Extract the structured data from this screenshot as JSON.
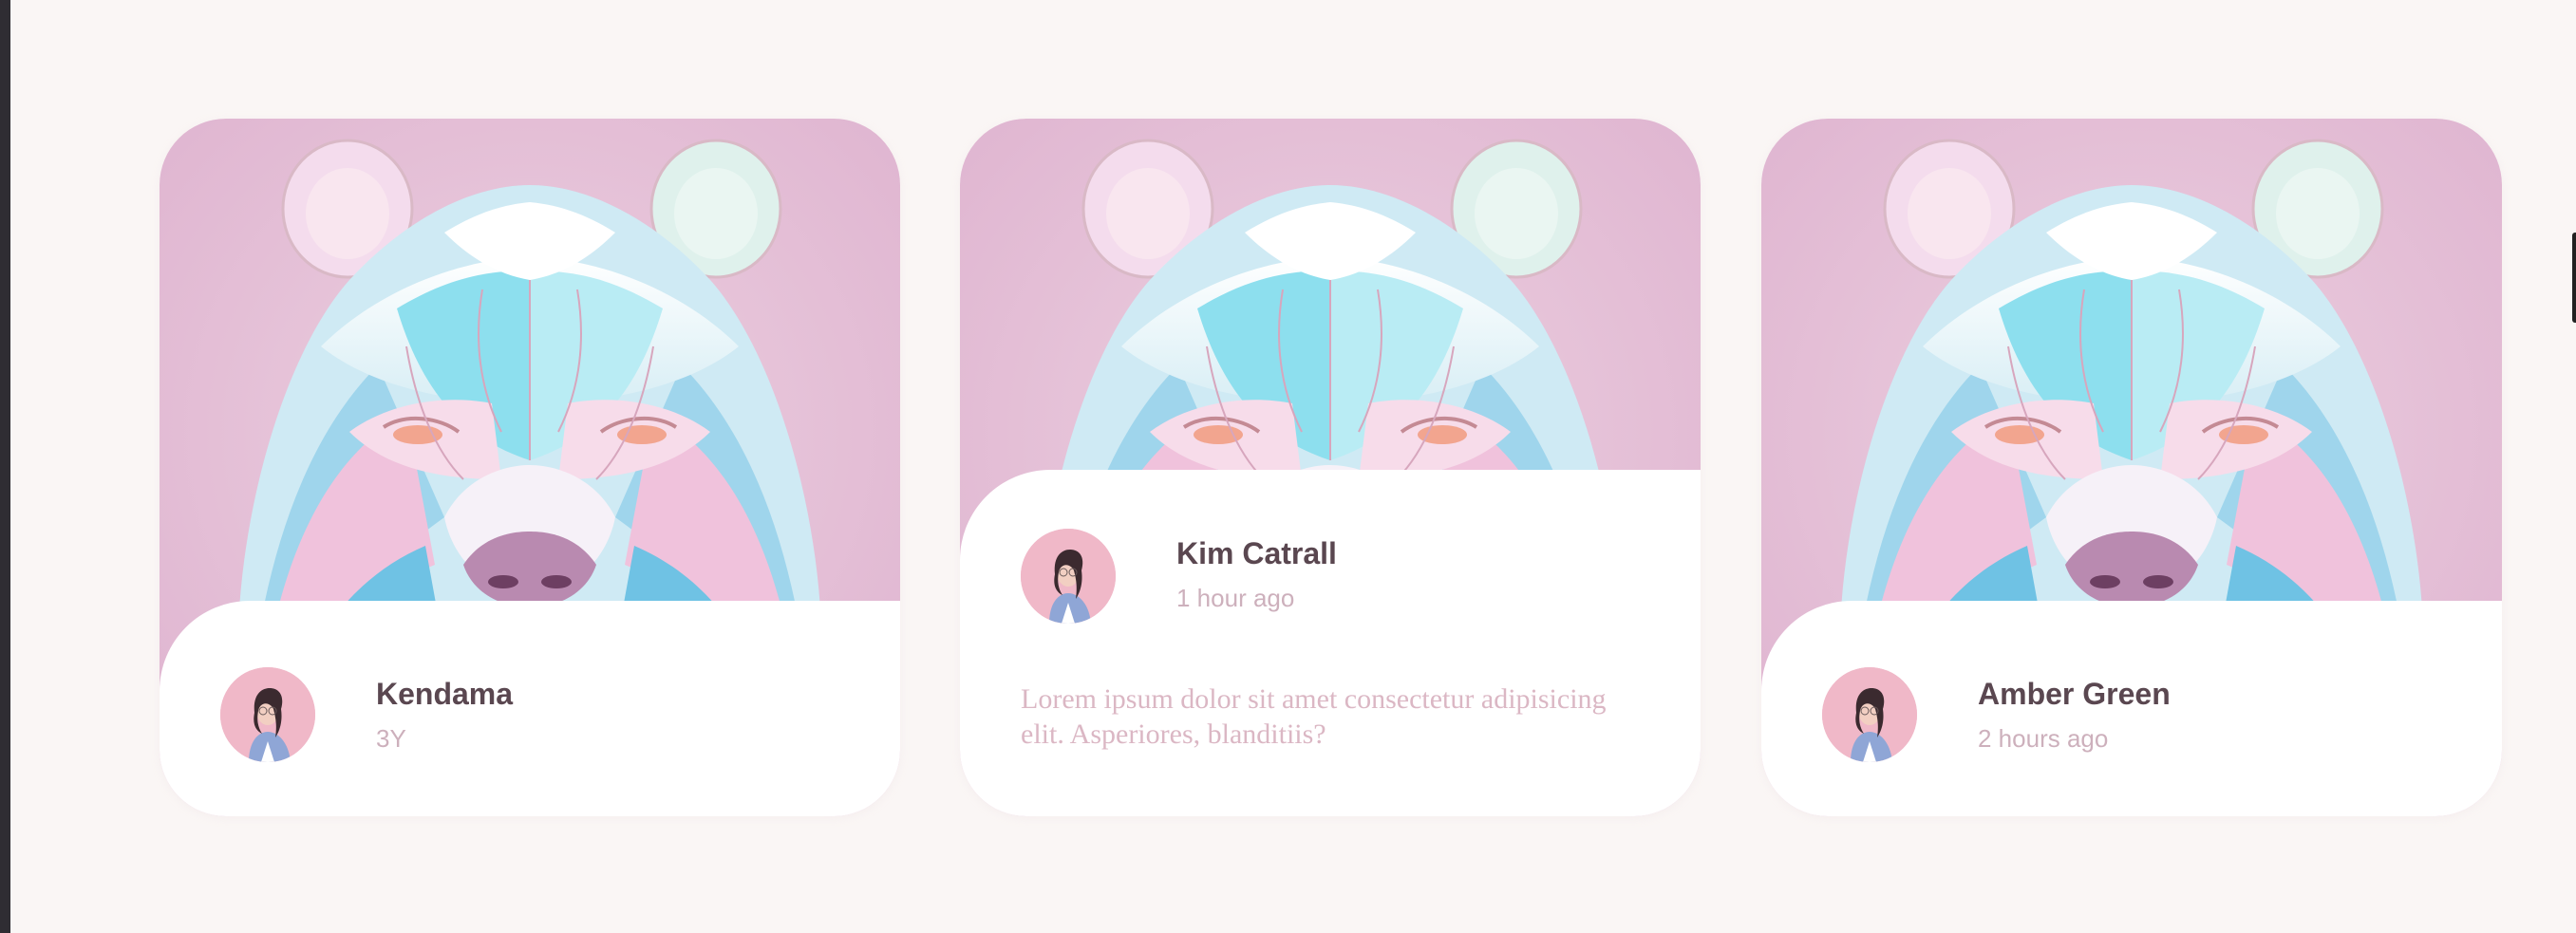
{
  "cards": [
    {
      "name": "Kendama",
      "time": "3Y",
      "description": ""
    },
    {
      "name": "Kim Catrall",
      "time": "1 hour ago",
      "description": "Lorem ipsum dolor sit amet consectetur adipisicing elit. Asperiores, blanditiis?"
    },
    {
      "name": "Amber Green",
      "time": "2 hours ago",
      "description": ""
    }
  ],
  "colors": {
    "background": "#faf6f5",
    "card": "#ffffff",
    "art_background": "#e3bdd6",
    "name": "#5a4750",
    "time": "#cdb0bc",
    "description": "#dbb7c4"
  },
  "icons": {
    "card_image": "bear-illustration",
    "avatar": "user-avatar"
  }
}
